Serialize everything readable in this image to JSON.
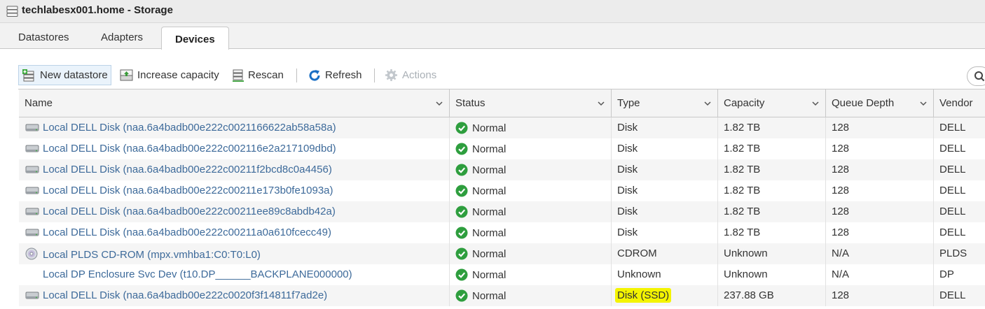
{
  "window": {
    "title": "techlabesx001.home - Storage"
  },
  "tabs": [
    {
      "label": "Datastores",
      "active": false
    },
    {
      "label": "Adapters",
      "active": false
    },
    {
      "label": "Devices",
      "active": true
    }
  ],
  "toolbar": {
    "new_datastore": "New datastore",
    "increase_capacity": "Increase capacity",
    "rescan": "Rescan",
    "refresh": "Refresh",
    "actions": "Actions"
  },
  "table": {
    "columns": [
      "Name",
      "Status",
      "Type",
      "Capacity",
      "Queue Depth",
      "Vendor"
    ],
    "rows": [
      {
        "icon": "disk-icon",
        "name": "Local DELL Disk (naa.6a4badb00e222c0021166622ab58a58a)",
        "status": "Normal",
        "type": "Disk",
        "capacity": "1.82 TB",
        "queue_depth": "128",
        "vendor": "DELL"
      },
      {
        "icon": "disk-icon",
        "name": "Local DELL Disk (naa.6a4badb00e222c002116e2a217109dbd)",
        "status": "Normal",
        "type": "Disk",
        "capacity": "1.82 TB",
        "queue_depth": "128",
        "vendor": "DELL"
      },
      {
        "icon": "disk-icon",
        "name": "Local DELL Disk (naa.6a4badb00e222c00211f2bcd8c0a4456)",
        "status": "Normal",
        "type": "Disk",
        "capacity": "1.82 TB",
        "queue_depth": "128",
        "vendor": "DELL"
      },
      {
        "icon": "disk-icon",
        "name": "Local DELL Disk (naa.6a4badb00e222c00211e173b0fe1093a)",
        "status": "Normal",
        "type": "Disk",
        "capacity": "1.82 TB",
        "queue_depth": "128",
        "vendor": "DELL"
      },
      {
        "icon": "disk-icon",
        "name": "Local DELL Disk (naa.6a4badb00e222c00211ee89c8abdb42a)",
        "status": "Normal",
        "type": "Disk",
        "capacity": "1.82 TB",
        "queue_depth": "128",
        "vendor": "DELL"
      },
      {
        "icon": "disk-icon",
        "name": "Local DELL Disk (naa.6a4badb00e222c00211a0a610fcecc49)",
        "status": "Normal",
        "type": "Disk",
        "capacity": "1.82 TB",
        "queue_depth": "128",
        "vendor": "DELL"
      },
      {
        "icon": "cdrom-icon",
        "name": "Local PLDS CD-ROM (mpx.vmhba1:C0:T0:L0)",
        "status": "Normal",
        "type": "CDROM",
        "capacity": "Unknown",
        "queue_depth": "N/A",
        "vendor": "PLDS"
      },
      {
        "icon": "",
        "name": "Local DP Enclosure Svc Dev (t10.DP______BACKPLANE000000)",
        "status": "Normal",
        "type": "Unknown",
        "capacity": "Unknown",
        "queue_depth": "N/A",
        "vendor": "DP"
      },
      {
        "icon": "disk-icon",
        "name": "Local DELL Disk (naa.6a4badb00e222c0020f3f14811f7ad2e)",
        "status": "Normal",
        "type": "Disk (SSD)",
        "capacity": "237.88 GB",
        "queue_depth": "128",
        "vendor": "DELL",
        "highlight_type": true
      }
    ]
  },
  "colors": {
    "link": "#3d6a9a",
    "ok_green": "#2e9e3e",
    "highlight": "#f4f400",
    "refresh_blue": "#1a6fc4"
  }
}
